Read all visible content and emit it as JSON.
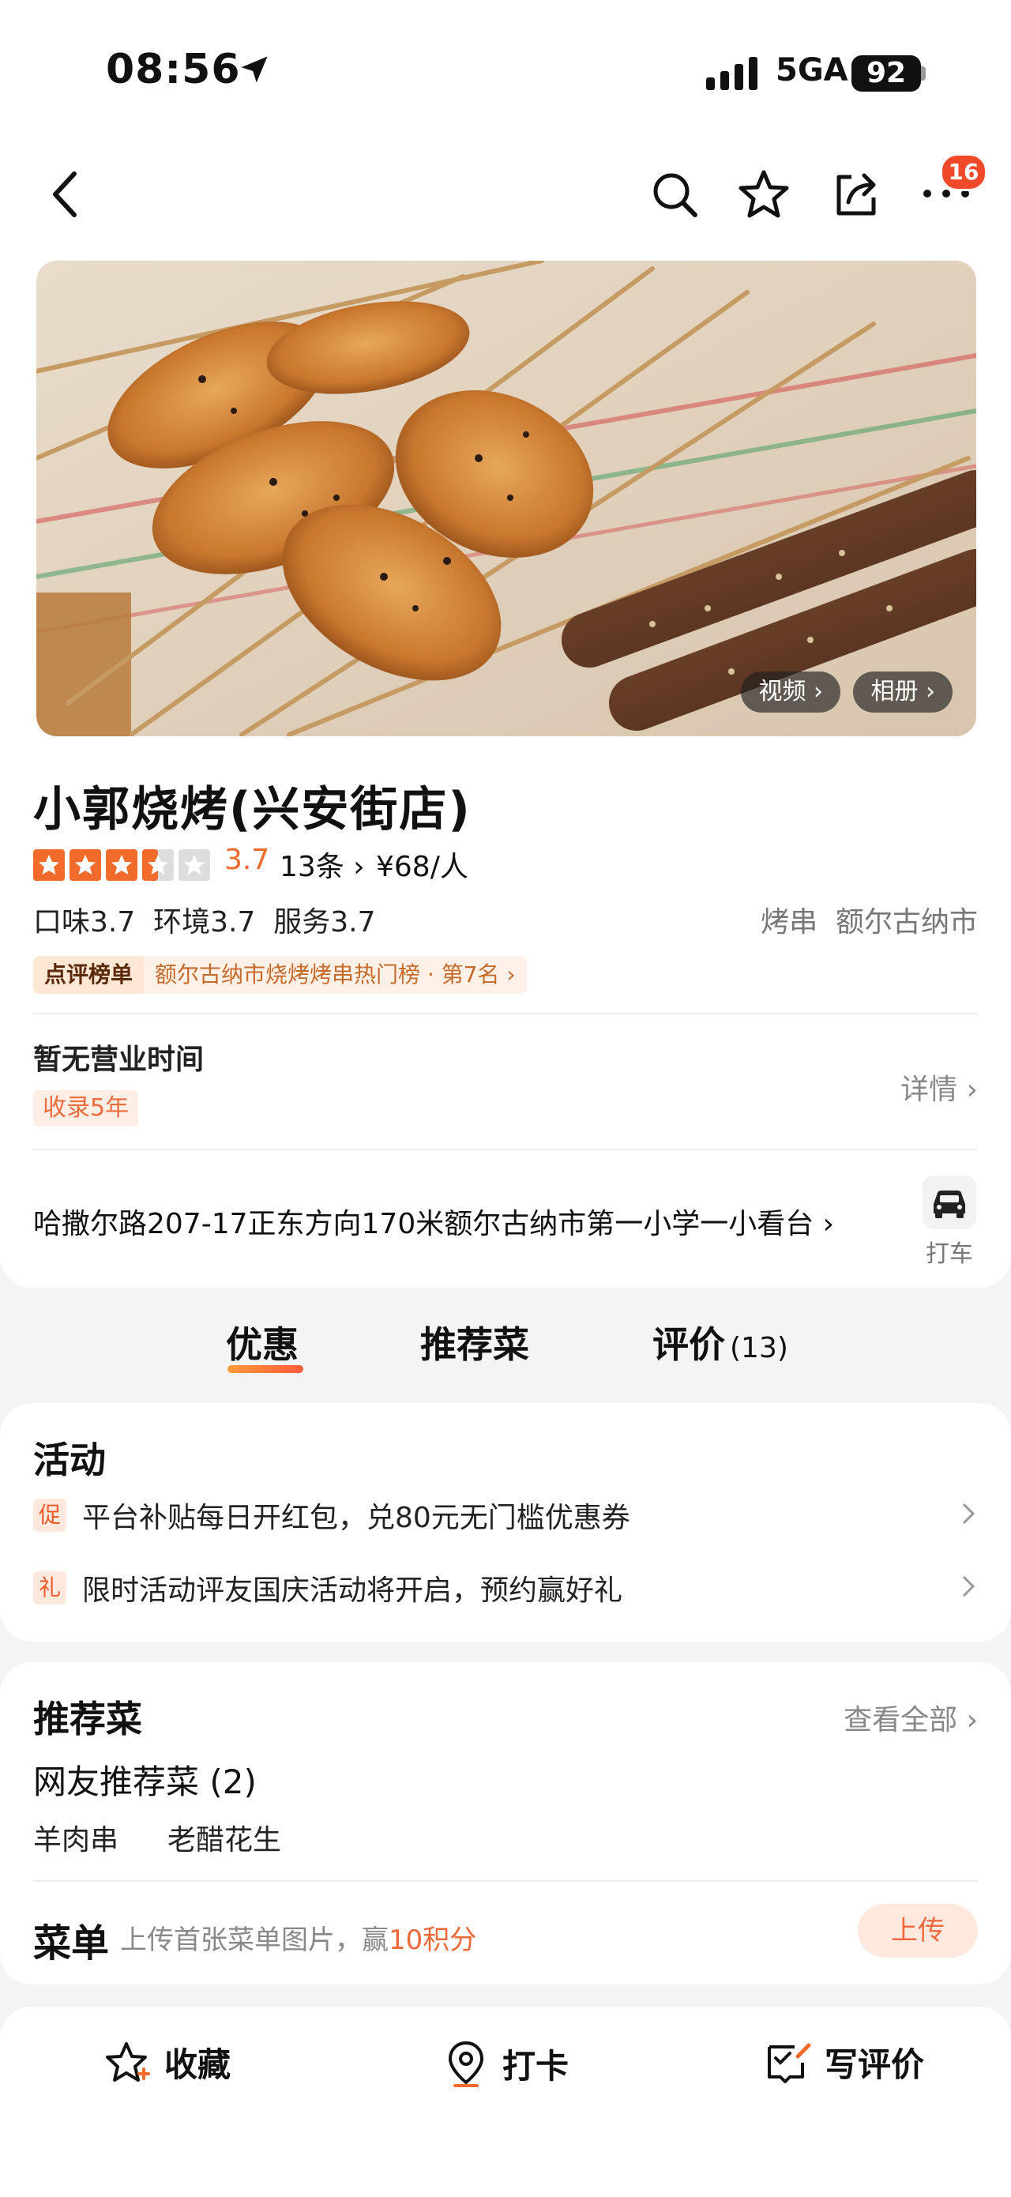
{
  "status": {
    "time": "08:56",
    "network": "5GA",
    "battery": "92"
  },
  "topnav": {
    "badge": "16"
  },
  "hero": {
    "video_label": "视频 ›",
    "album_label": "相册 ›"
  },
  "shop": {
    "name": "小郭烧烤(兴安街店)",
    "rating": "3.7",
    "rating_stars": 3.5,
    "reviews": "13条 ›",
    "price": "¥68/人",
    "scores": "口味3.7  环境3.7  服务3.7",
    "categories": "烤串  额尔古纳市",
    "rank_tag": "点评榜单",
    "rank_text": "额尔古纳市烧烤烤串热门榜 · 第7名 ›",
    "hours": "暂无营业时间",
    "since": "收录5年",
    "detail": "详情 ›",
    "address": "哈撒尔路207-17正东方向170米额尔古纳市第一小学一小看台 ›",
    "taxi_label": "打车"
  },
  "tabs": [
    {
      "label": "优惠"
    },
    {
      "label": "推荐菜"
    },
    {
      "label": "评价",
      "count": "(13)"
    }
  ],
  "activity": {
    "title": "活动",
    "items": [
      {
        "badge": "促",
        "text": "平台补贴每日开红包，兑80元无门槛优惠券"
      },
      {
        "badge": "礼",
        "text": "限时活动评友国庆活动将开启，预约赢好礼"
      }
    ]
  },
  "recommend": {
    "title": "推荐菜",
    "view_all": "查看全部 ›",
    "subtitle": "网友推荐菜 (2)",
    "dishes": [
      "羊肉串",
      "老醋花生"
    ],
    "menu_title": "菜单",
    "menu_text_prefix": "上传首张菜单图片，赢",
    "menu_text_highlight": "10积分",
    "upload": "上传"
  },
  "bottom": {
    "collect": "收藏",
    "checkin": "打卡",
    "review": "写评价"
  },
  "colors": {
    "accent": "#f26b2b",
    "badge": "#f04a2b",
    "star": "#f26b2b"
  }
}
